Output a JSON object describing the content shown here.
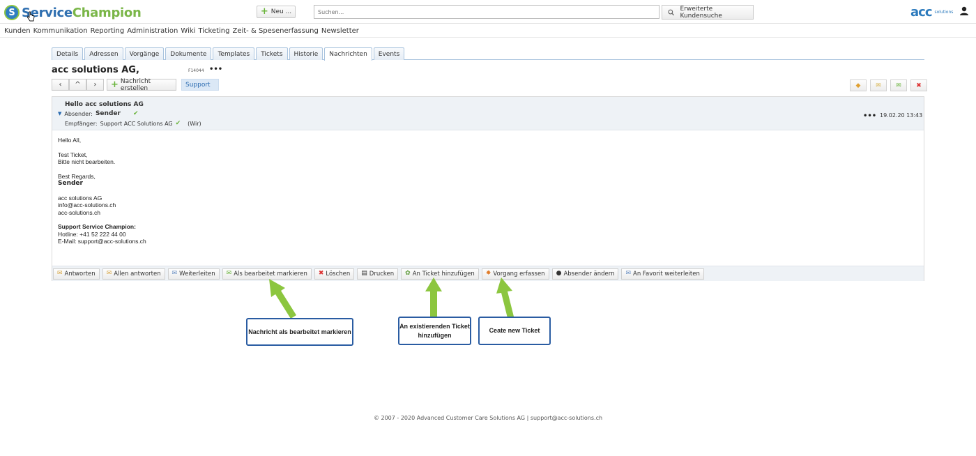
{
  "header": {
    "logo_letter": "S",
    "logo_part1": "Service",
    "logo_part2": "Champion",
    "new_button": "Neu ...",
    "search_placeholder": "Suchen...",
    "extended_search": "Erweiterte Kundensuche",
    "brand_acc": "acc",
    "brand_solutions": "solutions"
  },
  "menu": [
    "Kunden",
    "Kommunikation",
    "Reporting",
    "Administration",
    "Wiki",
    "Ticketing",
    "Zeit- & Spesenerfassung",
    "Newsletter"
  ],
  "tabs": [
    "Details",
    "Adressen",
    "Vorgänge",
    "Dokumente",
    "Templates",
    "Tickets",
    "Historie",
    "Nachrichten",
    "Events"
  ],
  "active_tab": "Nachrichten",
  "customer": {
    "name": "acc solutions AG,",
    "id": "F14044",
    "more": "•••"
  },
  "toolbar": {
    "prev": "‹",
    "up": "^",
    "next": "›",
    "new_message": "Nachricht erstellen",
    "tag": "Support"
  },
  "message": {
    "subject": "Hello acc solutions AG",
    "sender_label": "Absender:",
    "sender_name": "Sender",
    "recipient_label": "Empfänger:",
    "recipient_name": "Support ACC Solutions AG",
    "recipient_note": "(Wir)",
    "more": "•••",
    "date": "19.02.20 13:43",
    "body": {
      "greeting": "Hello All,",
      "line1": "Test Ticket,",
      "line2": "Bitte nicht bearbeiten.",
      "regards": "Best Regards,",
      "sig_name": "Sender",
      "company": "acc solutions AG",
      "email": "info@acc-solutions.ch",
      "web": "acc-solutions.ch",
      "support_title": "Support Service Champion:",
      "hotline": "Hotline: +41 52 222 44 00",
      "support_email": "E-Mail: support@acc-solutions.ch"
    }
  },
  "actions": [
    {
      "label": "Antworten",
      "icon": "reply-icon"
    },
    {
      "label": "Allen antworten",
      "icon": "reply-all-icon"
    },
    {
      "label": "Weiterleiten",
      "icon": "forward-icon"
    },
    {
      "label": "Als bearbeitet markieren",
      "icon": "mark-done-icon"
    },
    {
      "label": "Löschen",
      "icon": "delete-icon"
    },
    {
      "label": "Drucken",
      "icon": "print-icon"
    },
    {
      "label": "An Ticket hinzufügen",
      "icon": "add-ticket-icon"
    },
    {
      "label": "Vorgang erfassen",
      "icon": "create-case-icon"
    },
    {
      "label": "Absender ändern",
      "icon": "change-sender-icon"
    },
    {
      "label": "An Favorit weiterleiten",
      "icon": "forward-favorite-icon"
    }
  ],
  "annotations": {
    "mark_done": "Nachricht als bearbeitet markieren",
    "add_ticket": "An existierenden Ticket hinzufügen",
    "new_ticket": "Ceate new Ticket",
    "arrow_color": "#8cc63f",
    "box_color": "#2a5ca2"
  },
  "footer": "© 2007 - 2020  Advanced Customer Care Solutions AG  |  support@acc-solutions.ch",
  "colors": {
    "brand_blue": "#2f6fb0",
    "brand_green": "#7ab648",
    "header_bg": "#eef2f6"
  }
}
